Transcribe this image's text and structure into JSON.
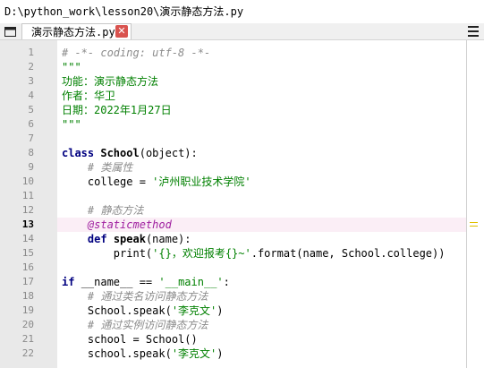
{
  "title_path": "D:\\python_work\\lesson20\\演示静态方法.py",
  "tab": {
    "label": "演示静态方法.py",
    "close_glyph": "✕"
  },
  "current_line": 13,
  "lines": [
    {
      "n": "1",
      "segs": [
        {
          "t": "# -*- coding: utf-8 -*-",
          "c": "cm"
        }
      ]
    },
    {
      "n": "2",
      "segs": [
        {
          "t": "\"\"\"",
          "c": "st"
        }
      ]
    },
    {
      "n": "3",
      "segs": [
        {
          "t": "功能：演示静态方法",
          "c": "st"
        }
      ]
    },
    {
      "n": "4",
      "segs": [
        {
          "t": "作者：华卫",
          "c": "st"
        }
      ]
    },
    {
      "n": "5",
      "segs": [
        {
          "t": "日期：2022年1月27日",
          "c": "st"
        }
      ]
    },
    {
      "n": "6",
      "segs": [
        {
          "t": "\"\"\"",
          "c": "st"
        }
      ]
    },
    {
      "n": "7",
      "segs": []
    },
    {
      "n": "8",
      "segs": [
        {
          "t": "class ",
          "c": "kw"
        },
        {
          "t": "School",
          "c": "fn"
        },
        {
          "t": "(object):",
          "c": "nm"
        }
      ]
    },
    {
      "n": "9",
      "segs": [
        {
          "t": "    ",
          "c": "nm"
        },
        {
          "t": "# 类属性",
          "c": "cm"
        }
      ]
    },
    {
      "n": "10",
      "segs": [
        {
          "t": "    college = ",
          "c": "nm"
        },
        {
          "t": "'泸州职业技术学院'",
          "c": "st"
        }
      ]
    },
    {
      "n": "11",
      "segs": []
    },
    {
      "n": "12",
      "segs": [
        {
          "t": "    ",
          "c": "nm"
        },
        {
          "t": "# 静态方法",
          "c": "cm"
        }
      ]
    },
    {
      "n": "13",
      "segs": [
        {
          "t": "    ",
          "c": "nm"
        },
        {
          "t": "@staticmethod",
          "c": "dec"
        }
      ]
    },
    {
      "n": "14",
      "segs": [
        {
          "t": "    ",
          "c": "nm"
        },
        {
          "t": "def ",
          "c": "kw"
        },
        {
          "t": "speak",
          "c": "fn"
        },
        {
          "t": "(name):",
          "c": "nm"
        }
      ]
    },
    {
      "n": "15",
      "segs": [
        {
          "t": "        print(",
          "c": "nm"
        },
        {
          "t": "'{}，欢迎报考{}~'",
          "c": "st"
        },
        {
          "t": ".format(name, School.college))",
          "c": "nm"
        }
      ]
    },
    {
      "n": "16",
      "segs": []
    },
    {
      "n": "17",
      "segs": [
        {
          "t": "if ",
          "c": "kw"
        },
        {
          "t": "__name__ == ",
          "c": "nm"
        },
        {
          "t": "'__main__'",
          "c": "st"
        },
        {
          "t": ":",
          "c": "nm"
        }
      ]
    },
    {
      "n": "18",
      "segs": [
        {
          "t": "    ",
          "c": "nm"
        },
        {
          "t": "# 通过类名访问静态方法",
          "c": "cm"
        }
      ]
    },
    {
      "n": "19",
      "segs": [
        {
          "t": "    School.speak(",
          "c": "nm"
        },
        {
          "t": "'李克文'",
          "c": "st"
        },
        {
          "t": ")",
          "c": "nm"
        }
      ]
    },
    {
      "n": "20",
      "segs": [
        {
          "t": "    ",
          "c": "nm"
        },
        {
          "t": "# 通过实例访问静态方法",
          "c": "cm"
        }
      ]
    },
    {
      "n": "21",
      "segs": [
        {
          "t": "    school = School()",
          "c": "nm"
        }
      ]
    },
    {
      "n": "22",
      "segs": [
        {
          "t": "    school.speak(",
          "c": "nm"
        },
        {
          "t": "'李克文'",
          "c": "st"
        },
        {
          "t": ")",
          "c": "nm"
        }
      ]
    }
  ]
}
